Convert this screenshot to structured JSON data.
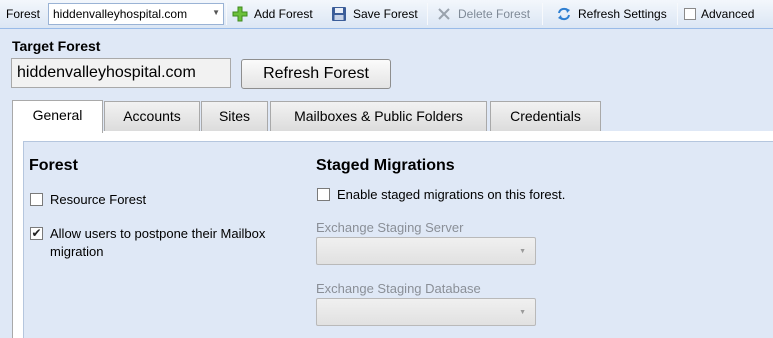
{
  "toolbar": {
    "forest_label": "Forest",
    "forest_select_value": "hiddenvalleyhospital.com",
    "add_forest": "Add Forest",
    "save_forest": "Save Forest",
    "delete_forest": "Delete Forest",
    "refresh_settings": "Refresh Settings",
    "advanced": "Advanced",
    "advanced_checked": false
  },
  "target": {
    "title": "Target Forest",
    "value": "hiddenvalleyhospital.com",
    "refresh_button": "Refresh Forest"
  },
  "tabs": [
    {
      "label": "General",
      "active": true
    },
    {
      "label": "Accounts",
      "active": false
    },
    {
      "label": "Sites",
      "active": false
    },
    {
      "label": "Mailboxes & Public Folders",
      "active": false
    },
    {
      "label": "Credentials",
      "active": false
    }
  ],
  "general": {
    "forest_section": {
      "title": "Forest",
      "resource_forest": {
        "label": "Resource Forest",
        "checked": false
      },
      "allow_postpone": {
        "label_line1": "Allow users to postpone their Mailbox",
        "label_line2": "migration",
        "checked": true
      }
    },
    "staged_section": {
      "title": "Staged Migrations",
      "enable_staged": {
        "label": "Enable staged migrations on this forest.",
        "checked": false
      },
      "staging_server": {
        "label": "Exchange Staging Server",
        "value": ""
      },
      "staging_database": {
        "label": "Exchange Staging Database",
        "value": ""
      }
    }
  },
  "colors": {
    "background": "#dfe8f6",
    "toolbar_border": "#99bbe8",
    "add_icon": "#5cb531",
    "refresh_icon": "#2e7fd1"
  },
  "icons": {
    "add": "plus-icon",
    "save": "floppy-disk-icon",
    "delete": "x-icon",
    "refresh": "refresh-arrows-icon"
  }
}
